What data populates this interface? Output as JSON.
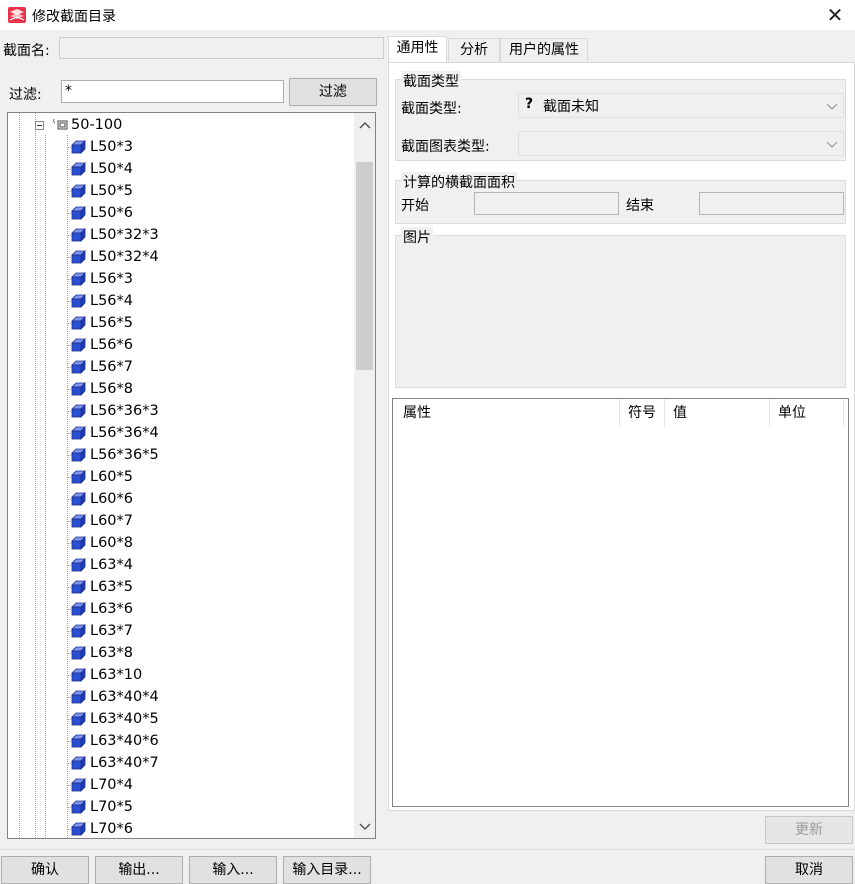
{
  "window": {
    "title": "修改截面目录",
    "close_symbol": "✕"
  },
  "section_name": {
    "label": "截面名:",
    "value": ""
  },
  "filter": {
    "label": "过滤:",
    "value": "*",
    "button_label": "过滤"
  },
  "tree": {
    "group_label": "50-100",
    "items": [
      "L50*3",
      "L50*4",
      "L50*5",
      "L50*6",
      "L50*32*3",
      "L50*32*4",
      "L56*3",
      "L56*4",
      "L56*5",
      "L56*6",
      "L56*7",
      "L56*8",
      "L56*36*3",
      "L56*36*4",
      "L56*36*5",
      "L60*5",
      "L60*6",
      "L60*7",
      "L60*8",
      "L63*4",
      "L63*5",
      "L63*6",
      "L63*7",
      "L63*8",
      "L63*10",
      "L63*40*4",
      "L63*40*5",
      "L63*40*6",
      "L63*40*7",
      "L70*4",
      "L70*5",
      "L70*6"
    ]
  },
  "tabs": [
    {
      "label": "通用性",
      "active": true
    },
    {
      "label": "分析",
      "active": false
    },
    {
      "label": "用户的属性",
      "active": false
    }
  ],
  "general": {
    "section_type_group": "截面类型",
    "section_type_label": "截面类型:",
    "section_type_value": "截面未知",
    "section_type_icon": "?",
    "chart_type_label": "截面图表类型:",
    "chart_type_value": "",
    "area_group": "计算的横截面面积",
    "start_label": "开始",
    "start_value": "",
    "end_label": "结束",
    "end_value": "",
    "picture_group": "图片"
  },
  "properties_table": {
    "columns": [
      "属性",
      "符号",
      "值",
      "单位"
    ],
    "rows": []
  },
  "buttons": {
    "update": "更新",
    "ok": "确认",
    "export": "输出...",
    "import": "输入...",
    "import_catalog": "输入目录...",
    "cancel": "取消"
  },
  "colors": {
    "app_icon_red": "#e8334a",
    "cube_blue": "#2a4fd0",
    "disabled_text": "#9a9a9a"
  },
  "icons": {
    "app": "red-lattice-logo",
    "tree_item": "blue-cube-icon",
    "group": "folder-expand-icon"
  }
}
